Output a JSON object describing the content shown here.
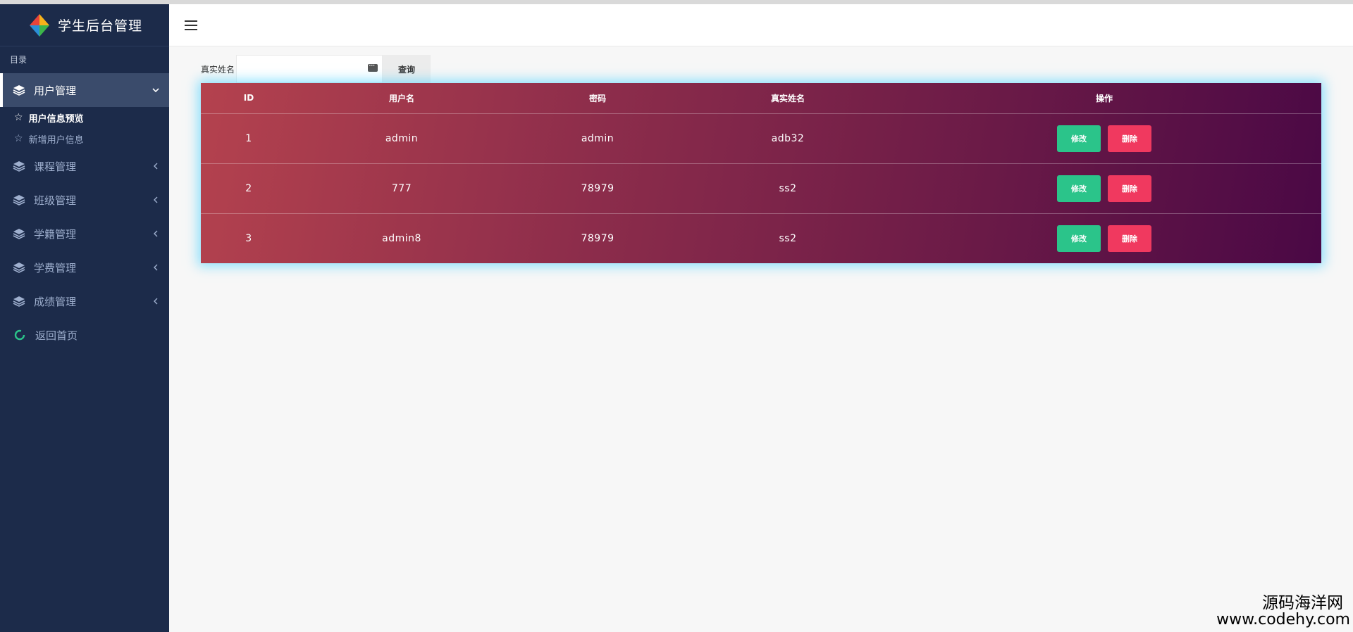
{
  "brand": {
    "title": "学生后台管理"
  },
  "sidebar": {
    "header": "目录",
    "items": [
      {
        "label": "用户管理",
        "active": true,
        "children": [
          {
            "label": "用户信息预览",
            "active": true
          },
          {
            "label": "新增用户信息",
            "active": false
          }
        ]
      },
      {
        "label": "课程管理",
        "active": false
      },
      {
        "label": "班级管理",
        "active": false
      },
      {
        "label": "学籍管理",
        "active": false
      },
      {
        "label": "学费管理",
        "active": false
      },
      {
        "label": "成绩管理",
        "active": false
      }
    ],
    "home": {
      "label": "返回首页"
    }
  },
  "search": {
    "label": "真实姓名",
    "value": "",
    "button_label": "查询"
  },
  "table": {
    "headers": [
      "ID",
      "用户名",
      "密码",
      "真实姓名",
      "操作"
    ],
    "rows": [
      {
        "id": "1",
        "username": "admin",
        "password": "admin",
        "realname": "adb32"
      },
      {
        "id": "2",
        "username": "777",
        "password": "78979",
        "realname": "ss2"
      },
      {
        "id": "3",
        "username": "admin8",
        "password": "78979",
        "realname": "ss2"
      }
    ],
    "edit_label": "修改",
    "delete_label": "删除"
  },
  "watermark": {
    "name": "源码海洋网",
    "url": "www.codehy.com"
  },
  "colors": {
    "sidebar_bg": "#1c2b4a",
    "active_item_bg": "#3a4b6b",
    "edit_button": "#2bc48a",
    "delete_button": "#f0395f",
    "table_gradient_start": "#b4424e",
    "table_gradient_end": "#4a0845",
    "table_glow": "#50d2ff"
  }
}
